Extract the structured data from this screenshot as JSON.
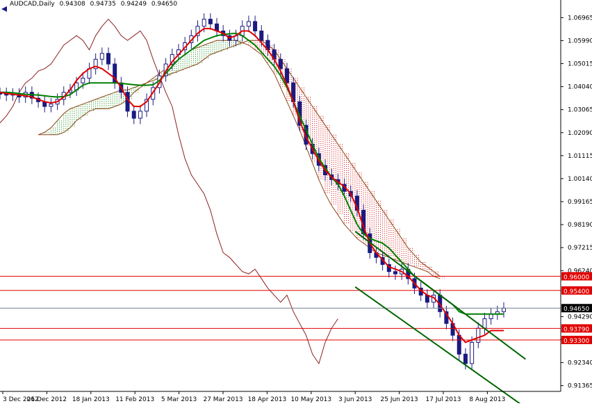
{
  "header": {
    "symbol": "AUDCAD,Daily",
    "open": "0.94308",
    "high": "0.94735",
    "low": "0.94249",
    "close": "0.94650"
  },
  "colors": {
    "background": "#ffffff",
    "candle_body": "#1a1a80",
    "tenkan": "#e00000",
    "kijun": "#008000",
    "chikou": "#8b2020",
    "kumo_bull": "#008000",
    "kumo_bear": "#d00000",
    "level_line": "#e00000",
    "price_line": "#708090",
    "channel": "#006400"
  },
  "chart_data": {
    "type": "candlestick",
    "title": "AUDCAD,Daily",
    "ylim": [
      0.9112,
      1.073
    ],
    "y_ticks": [
      "1.06965",
      "1.05990",
      "1.05015",
      "1.04040",
      "1.03065",
      "1.02090",
      "1.01115",
      "1.00140",
      "0.99165",
      "0.98190",
      "0.97215",
      "0.96240",
      "0.94290",
      "0.93315",
      "0.92340",
      "0.91365"
    ],
    "x_ticks": [
      "3 Dec 2012",
      "26 Dec 2012",
      "18 Jan 2013",
      "11 Feb 2013",
      "5 Mar 2013",
      "27 Mar 2013",
      "18 Apr 2013",
      "10 May 2013",
      "3 Jun 2013",
      "25 Jun 2013",
      "17 Jul 2013",
      "8 Aug 2013"
    ],
    "horizontal_levels": [
      {
        "label": "0.96000",
        "value": 0.96
      },
      {
        "label": "0.95400",
        "value": 0.954
      },
      {
        "label": "0.93790",
        "value": 0.9379
      },
      {
        "label": "0.93300",
        "value": 0.933
      }
    ],
    "current_price": {
      "label": "0.94650",
      "value": 0.9465
    },
    "channel_lines": [
      {
        "from": [
          "3 Jun 2013",
          0.979
        ],
        "to": [
          "8 Aug 2013",
          0.937
        ]
      },
      {
        "from": [
          "3 Jun 2013",
          0.9555
        ],
        "to": [
          "8 Aug 2013",
          0.9158
        ]
      }
    ],
    "series": [
      {
        "name": "close",
        "values": [
          1.0375,
          1.0368,
          1.0372,
          1.036,
          1.038,
          1.0355,
          1.034,
          1.032,
          1.033,
          1.035,
          1.038,
          1.039,
          1.042,
          1.044,
          1.048,
          1.052,
          1.0545,
          1.05,
          1.042,
          1.038,
          1.03,
          1.027,
          1.03,
          1.035,
          1.04,
          1.045,
          1.05,
          1.054,
          1.056,
          1.059,
          1.062,
          1.066,
          1.069,
          1.067,
          1.064,
          1.062,
          1.06,
          1.062,
          1.066,
          1.068,
          1.064,
          1.06,
          1.056,
          1.052,
          1.048,
          1.042,
          1.034,
          1.024,
          1.016,
          1.012,
          1.007,
          1.003,
          1.001,
          0.999,
          0.996,
          0.994,
          0.988,
          0.978,
          0.97,
          0.968,
          0.965,
          0.962,
          0.961,
          0.963,
          0.959,
          0.955,
          0.952,
          0.949,
          0.952,
          0.945,
          0.94,
          0.935,
          0.927,
          0.923,
          0.932,
          0.938,
          0.942,
          0.944,
          0.945,
          0.9465
        ]
      },
      {
        "name": "tenkan",
        "values": [
          1.038,
          1.0375,
          1.0372,
          1.0368,
          1.0365,
          1.036,
          1.035,
          1.034,
          1.0335,
          1.034,
          1.036,
          1.039,
          1.043,
          1.046,
          1.048,
          1.049,
          1.048,
          1.046,
          1.044,
          1.04,
          1.035,
          1.032,
          1.032,
          1.034,
          1.038,
          1.042,
          1.047,
          1.051,
          1.054,
          1.057,
          1.06,
          1.063,
          1.065,
          1.065,
          1.064,
          1.063,
          1.061,
          1.062,
          1.064,
          1.064,
          1.062,
          1.059,
          1.056,
          1.052,
          1.047,
          1.041,
          1.034,
          1.026,
          1.019,
          1.014,
          1.009,
          1.005,
          1.002,
          1.0,
          0.998,
          0.995,
          0.989,
          0.981,
          0.974,
          0.97,
          0.967,
          0.964,
          0.963,
          0.962,
          0.96,
          0.957,
          0.954,
          0.952,
          0.951,
          0.948,
          0.944,
          0.94,
          0.935,
          0.932,
          0.933,
          0.934,
          0.935,
          0.937,
          0.937,
          0.937
        ]
      },
      {
        "name": "kijun",
        "values": [
          1.038,
          1.038,
          1.0378,
          1.0375,
          1.0372,
          1.037,
          1.0368,
          1.0365,
          1.0362,
          1.036,
          1.0362,
          1.037,
          1.039,
          1.041,
          1.042,
          1.042,
          1.042,
          1.042,
          1.042,
          1.0418,
          1.0415,
          1.0412,
          1.041,
          1.041,
          1.0412,
          1.043,
          1.046,
          1.049,
          1.052,
          1.054,
          1.056,
          1.058,
          1.06,
          1.061,
          1.062,
          1.0625,
          1.0628,
          1.063,
          1.062,
          1.06,
          1.058,
          1.055,
          1.052,
          1.049,
          1.045,
          1.04,
          1.034,
          1.028,
          1.022,
          1.016,
          1.01,
          1.006,
          1.002,
          0.999,
          0.994,
          0.988,
          0.982,
          0.978,
          0.976,
          0.975,
          0.974,
          0.972,
          0.969,
          0.966,
          0.963,
          0.96,
          0.958,
          0.956,
          0.954,
          0.952,
          0.95,
          0.948,
          0.945,
          0.944,
          0.944,
          0.944,
          0.944,
          0.944,
          0.944,
          0.944
        ]
      },
      {
        "name": "chikou",
        "values": [
          1.025,
          1.028,
          1.032,
          1.038,
          1.042,
          1.044,
          1.047,
          1.048,
          1.05,
          1.054,
          1.058,
          1.06,
          1.062,
          1.06,
          1.056,
          1.062,
          1.066,
          1.069,
          1.066,
          1.062,
          1.06,
          1.062,
          1.064,
          1.06,
          1.052,
          1.045,
          1.038,
          1.032,
          1.02,
          1.01,
          1.003,
          0.999,
          0.995,
          0.988,
          0.978,
          0.97,
          0.968,
          0.965,
          0.962,
          0.961,
          0.963,
          0.959,
          0.955,
          0.952,
          0.949,
          0.952,
          0.945,
          0.94,
          0.935,
          0.927,
          0.923,
          0.932,
          0.938,
          0.942
        ]
      },
      {
        "name": "kumo_span_a",
        "values": [
          1.02,
          1.021,
          1.023,
          1.026,
          1.029,
          1.031,
          1.032,
          1.033,
          1.034,
          1.035,
          1.036,
          1.037,
          1.038,
          1.039,
          1.039,
          1.04,
          1.041,
          1.042,
          1.044,
          1.046,
          1.048,
          1.05,
          1.052,
          1.054,
          1.056,
          1.057,
          1.058,
          1.059,
          1.06,
          1.06,
          1.06,
          1.06,
          1.059,
          1.058,
          1.056,
          1.054,
          1.05,
          1.046,
          1.04,
          1.034,
          1.028,
          1.022,
          1.015,
          1.008,
          1.001,
          0.995,
          0.99,
          0.986,
          0.982,
          0.979,
          0.976,
          0.974,
          0.972,
          0.97,
          0.969,
          0.968,
          0.967,
          0.966,
          0.965,
          0.964,
          0.963,
          0.962,
          0.96,
          0.959
        ]
      },
      {
        "name": "kumo_span_b",
        "values": [
          1.02,
          1.02,
          1.02,
          1.02,
          1.021,
          1.023,
          1.026,
          1.028,
          1.03,
          1.031,
          1.031,
          1.031,
          1.032,
          1.033,
          1.035,
          1.038,
          1.04,
          1.042,
          1.043,
          1.044,
          1.045,
          1.046,
          1.047,
          1.048,
          1.049,
          1.05,
          1.052,
          1.054,
          1.055,
          1.056,
          1.057,
          1.058,
          1.059,
          1.06,
          1.06,
          1.06,
          1.058,
          1.056,
          1.052,
          1.048,
          1.044,
          1.04,
          1.036,
          1.032,
          1.028,
          1.024,
          1.02,
          1.016,
          1.012,
          1.008,
          1.004,
          1.0,
          0.996,
          0.992,
          0.988,
          0.984,
          0.98,
          0.976,
          0.972,
          0.969,
          0.966,
          0.964,
          0.962,
          0.96
        ]
      }
    ],
    "grid": false,
    "legend": "none"
  }
}
